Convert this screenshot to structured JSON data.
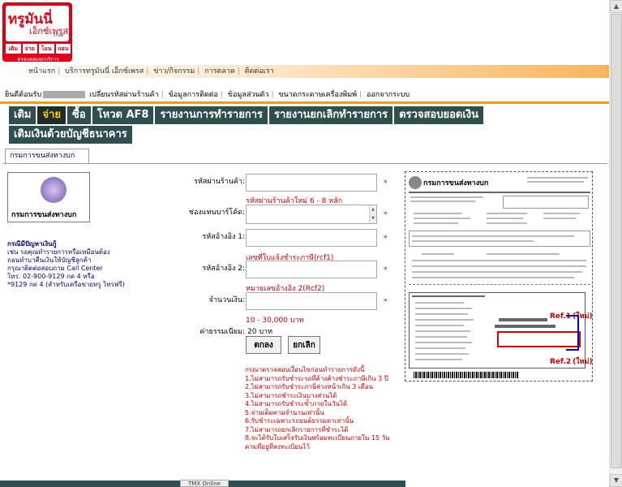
{
  "logo": {
    "title": "ทรูมันนี่",
    "subtitle": "เอ็กซ์เพรส",
    "brand": "true",
    "buttons": [
      "เติม",
      "จ่าย",
      "โอน",
      "ถอน"
    ],
    "tagline": "ครอบคลุมทุกบริการ"
  },
  "top_nav": {
    "items": [
      "หน้าแรก",
      "บริการทรูมันนี่ เอ็กซ์เพรส",
      "ข่าว/กิจกรรม",
      "การตลาด",
      "ติดต่อเรา"
    ]
  },
  "sub_nav": {
    "welcome": "ยินดีต้อนรับ",
    "items": [
      "เปลี่ยนรหัสผ่านร้านค้า",
      "ข้อมูลการติดต่อ",
      "ข้อมูลส่วนตัว",
      "ขนาดกระดาษเครื่องพิมพ์",
      "ออกจากระบบ"
    ]
  },
  "tabs": {
    "row1": [
      "เติม",
      "จ่าย",
      "ซื้อ",
      "โหวต AF8",
      "รายงานการทำรายการ",
      "รายงานยกเลิกทำรายการ",
      "ตรวจสอบยอดเงิน"
    ],
    "row2": [
      "เติมเงินด้วยบัญชีธนาคาร"
    ],
    "active": "จ่าย"
  },
  "subtab": "กรมการขนส่งทางบก",
  "agency": {
    "name": "กรมการขนส่งทางบก"
  },
  "info": {
    "heading": "กรณีมีปัญหาเงินกู้",
    "lines": [
      "เช่น รอคุณทำรายการหรือเหมือนต้อง",
      "ถอนทำบาคืนเงินให้บัญชีลูกค้า",
      "กรุณาติดต่อสอบถาม Call Center",
      "โทร. 02-900-9129 กด 4 หรือ",
      "*9129 กด 4 (สำหรับเครือข่ายทรู ไทรฟรี)"
    ]
  },
  "form": {
    "fields": [
      {
        "label": "รหัสผ่านร้านค้า:",
        "hint": "รหัสผ่านร้านค้าใหม่ 6 - 8 หลัก",
        "value": ""
      },
      {
        "label": "ช่องแทนบาร์โค้ด:",
        "hint": "",
        "value": ""
      },
      {
        "label": "รหัสอ้างอิง 1:",
        "hint": "เลขที่ใบแจ้งชำระภาษี(rcf1)",
        "value": ""
      },
      {
        "label": "รหัสอ้างอิง 2:",
        "hint": "หมายเลขอ้างอิง 2(Rcf2)",
        "value": ""
      },
      {
        "label": "จำนวนเงิน:",
        "hint": "10 - 30,000 บาท",
        "value": ""
      }
    ],
    "required_mark": "*",
    "fee_label": "ค่าธรรมเนียม:",
    "fee_value": "20 บาท",
    "confirm_label": "ตกลง",
    "cancel_label": "ยกเลิก"
  },
  "notes": {
    "title": "กรณาตรวจสอบเงื่อนไขก่อนทำรายการดังนี้",
    "items": [
      "1.ไม่สามารถรับชำระรถที่ค้างค้างชำระภาษีเกิน 3 ปี",
      "2.ไม่สามารถรับชำระภาษีล่วงหน้าเกิน 3 เดือน",
      "3.ไม่สามารถชำระเงินบางส่วนได้",
      "4.ไม่สามารถรับชำระซ้ำภายในวันได้",
      "5.จ่ายเต็มตามจำนวนเท่านั้น",
      "6.รับชำระเฉพาะรถยนต์ธรรมดาเท่านั้น",
      "7.ไม่สามารถยกเลิกรายการที่ชำระได้",
      "8.จะได้รับใบเสร็จรับเงินพร้อมทะเบียนภายใน 15 วัน",
      "ตามที่อยู่ที่ลงทะเบียนไว้"
    ]
  },
  "bill": {
    "header": "กรมการขนส่งทางบก",
    "ref1": "Ref.1",
    "ref1_tag": "(ใหม่)",
    "ref2": "Ref.2",
    "ref2_tag": "(ใหม่)"
  },
  "bottom": {
    "label": "TMX Online"
  }
}
